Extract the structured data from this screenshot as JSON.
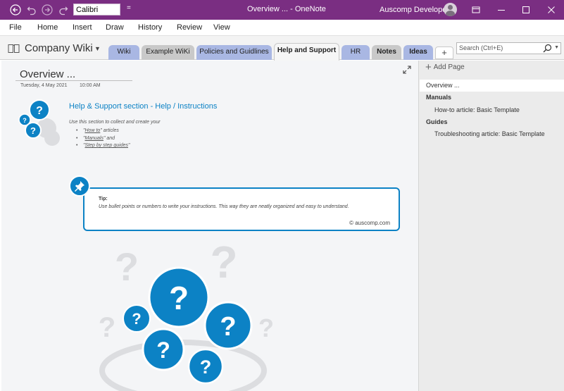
{
  "titlebar": {
    "font_name": "Calibri",
    "qa_more": "=",
    "window_title": "Overview ...  -  OneNote",
    "user_name": "Auscomp Developer"
  },
  "menu": [
    "File",
    "Home",
    "Insert",
    "Draw",
    "History",
    "Review",
    "View"
  ],
  "notebook": {
    "name": "Company Wiki",
    "tabs": [
      {
        "label": "Wiki",
        "color": "#a9b7e3"
      },
      {
        "label": "Example WiKi",
        "color": "#c9c9c9"
      },
      {
        "label": "Policies and Guidlines",
        "color": "#a9b7e3"
      },
      {
        "label": "Help and Support",
        "color": "#f6f6f6",
        "active": true
      },
      {
        "label": "HR",
        "color": "#a9b7e3"
      },
      {
        "label": "Notes",
        "color": "#c9c9c9"
      },
      {
        "label": "Ideas",
        "color": "#a9b7e3"
      }
    ],
    "add_tab": "+",
    "search_placeholder": "Search (Ctrl+E)"
  },
  "page": {
    "title": "Overview ...",
    "date": "Tuesday, 4 May 2021",
    "time": "10:00 AM",
    "section_heading": "Help & Support section - Help / Instructions",
    "intro": "Use this section to collect and create your",
    "bullets": [
      {
        "pre": "\"",
        "link": "How to",
        "post": "\" articles"
      },
      {
        "pre": "\"",
        "link": "Manuals",
        "post": "\"  and"
      },
      {
        "pre": "\"",
        "link": "Step by step guides",
        "post": "\""
      }
    ],
    "tip_label": "Tip:",
    "tip_text": "Use bullet points or numbers to write your instructions. This way they are neatly organized and easy to understand.",
    "copyright": "© auscomp.com",
    "question_mark": "?"
  },
  "pages_panel": {
    "add_page": "Add Page",
    "selected": "Overview ...",
    "items": [
      {
        "label": "Manuals",
        "bold": true
      },
      {
        "label": "How-to article: Basic Template",
        "bold": false
      },
      {
        "label": "Guides",
        "bold": true
      },
      {
        "label": "Troubleshooting article: Basic Template",
        "bold": false
      }
    ]
  },
  "colors": {
    "titlebar": "#7a2e82",
    "accent_blue": "#0c82c5",
    "canvas": "#f4f5f7"
  }
}
